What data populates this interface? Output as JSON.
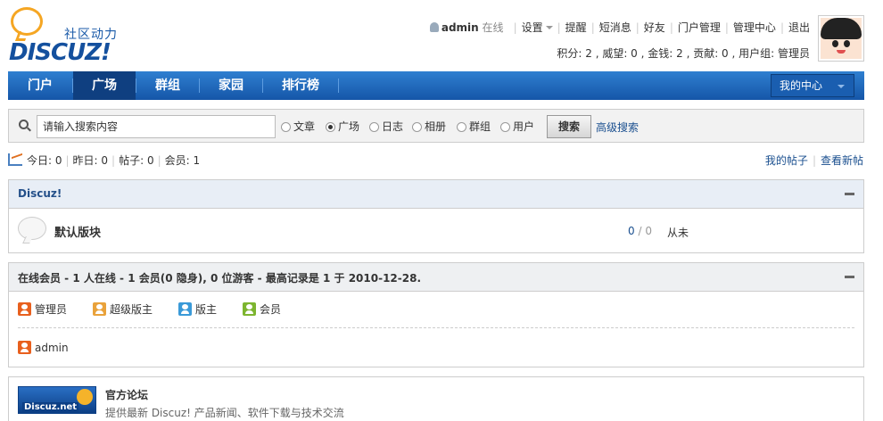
{
  "brand": {
    "tagline": "社区动力",
    "wordmark": "DISCUZ!"
  },
  "userbar": {
    "username": "admin",
    "status": "在线",
    "settings": "设置",
    "links": [
      "提醒",
      "短消息",
      "好友",
      "门户管理",
      "管理中心",
      "退出"
    ]
  },
  "credits": "积分: 2 , 威望: 0 , 金钱: 2 , 贡献: 0 , 用户组: 管理员",
  "nav": {
    "items": [
      "门户",
      "广场",
      "群组",
      "家园",
      "排行榜"
    ],
    "active": "广场",
    "my_center": "我的中心"
  },
  "search": {
    "placeholder": "请输入搜索内容",
    "options": [
      "文章",
      "广场",
      "日志",
      "相册",
      "群组",
      "用户"
    ],
    "selected": "广场",
    "button": "搜索",
    "advanced": "高级搜索"
  },
  "stats": {
    "today": "今日: 0",
    "yesterday": "昨日: 0",
    "posts": "帖子: 0",
    "members": "会员: 1",
    "my_posts": "我的帖子",
    "new_posts": "查看新帖"
  },
  "category": {
    "title": "Discuz!",
    "forum": {
      "name": "默认版块",
      "threads": "0",
      "posts": "0",
      "last_post": "从未"
    }
  },
  "online": {
    "title": "在线会员 - 1 人在线 - 1 会员(0 隐身), 0 位游客 - 最高记录是 1 于 2010-12-28.",
    "legend": [
      "管理员",
      "超级版主",
      "版主",
      "会员"
    ],
    "users": [
      "admin"
    ]
  },
  "links": {
    "logo_text": "Discuz.net",
    "name": "官方论坛",
    "desc": "提供最新 Discuz! 产品新闻、软件下载与技术交流"
  },
  "colors": {
    "nav_blue": "#1556a8",
    "link_blue": "#1a4f8f",
    "admin": "#e8601e",
    "super_mod": "#e9a23b",
    "mod": "#3a9ad8",
    "member": "#7db530"
  }
}
